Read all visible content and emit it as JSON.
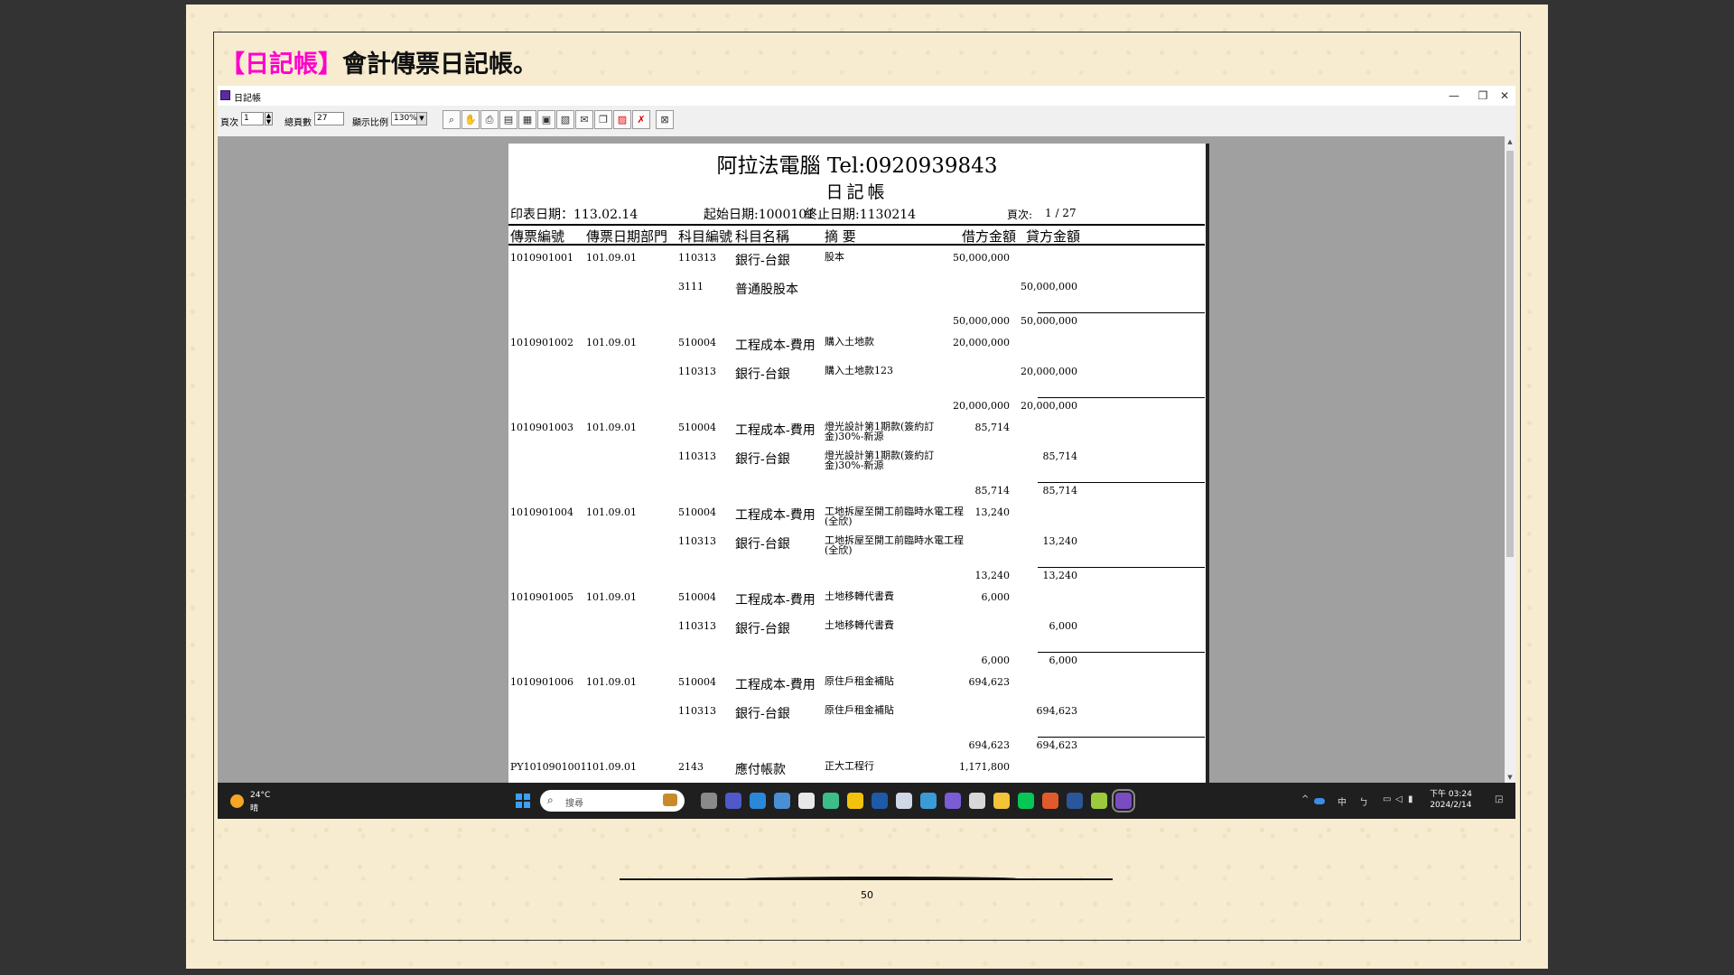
{
  "slide": {
    "heading_tag": "【日記帳】",
    "heading_text": "會計傳票日記帳。",
    "page_number": "50"
  },
  "window": {
    "title": "日記帳",
    "minimize": "—",
    "restore": "❐",
    "close": "✕"
  },
  "toolbar": {
    "page_label": "頁次",
    "page_value": "1",
    "total_label": "總頁數",
    "total_value": "27",
    "zoom_label": "顯示比例",
    "zoom_value": "130%",
    "buttons": [
      "search-icon",
      "hand-icon",
      "print-icon",
      "page-icon",
      "export-icon",
      "excel-icon",
      "word-icon",
      "mail-icon",
      "copy-icon",
      "pdf-icon",
      "delete-icon",
      "close-icon"
    ]
  },
  "report": {
    "company": "阿拉法電腦 Tel:0920939843",
    "title": "日記帳",
    "print_date": "印表日期：113.02.14",
    "start_date": "起始日期:1000101",
    "end_date": "終止日期:1130214",
    "page_label": "頁次:",
    "page_value": "1 / 27",
    "headers": [
      "傳票編號",
      "傳票日期",
      "部門",
      "科目編號",
      "科目名稱",
      "摘 要",
      "借方金額",
      "貸方金額"
    ],
    "vouchers": [
      {
        "no": "1010901001",
        "date": "101.09.01",
        "lines": [
          {
            "code": "110313",
            "name": "銀行-台銀",
            "desc": "股本",
            "debit": "50,000,000",
            "credit": ""
          },
          {
            "code": "3111",
            "name": "普通股股本",
            "desc": "",
            "debit": "",
            "credit": "50,000,000"
          }
        ],
        "total_debit": "50,000,000",
        "total_credit": "50,000,000"
      },
      {
        "no": "1010901002",
        "date": "101.09.01",
        "lines": [
          {
            "code": "510004",
            "name": "工程成本-費用",
            "desc": "購入土地款",
            "debit": "20,000,000",
            "credit": ""
          },
          {
            "code": "110313",
            "name": "銀行-台銀",
            "desc": "購入土地款123",
            "debit": "",
            "credit": "20,000,000"
          }
        ],
        "total_debit": "20,000,000",
        "total_credit": "20,000,000"
      },
      {
        "no": "1010901003",
        "date": "101.09.01",
        "lines": [
          {
            "code": "510004",
            "name": "工程成本-費用",
            "desc": "燈光設計第1期款(簽約訂金)30%-新源",
            "debit": "85,714",
            "credit": ""
          },
          {
            "code": "110313",
            "name": "銀行-台銀",
            "desc": "燈光設計第1期款(簽約訂金)30%-新源",
            "debit": "",
            "credit": "85,714"
          }
        ],
        "total_debit": "85,714",
        "total_credit": "85,714"
      },
      {
        "no": "1010901004",
        "date": "101.09.01",
        "lines": [
          {
            "code": "510004",
            "name": "工程成本-費用",
            "desc": "工地拆屋至開工前臨時水電工程(全欣)",
            "debit": "13,240",
            "credit": ""
          },
          {
            "code": "110313",
            "name": "銀行-台銀",
            "desc": "工地拆屋至開工前臨時水電工程(全欣)",
            "debit": "",
            "credit": "13,240"
          }
        ],
        "total_debit": "13,240",
        "total_credit": "13,240"
      },
      {
        "no": "1010901005",
        "date": "101.09.01",
        "lines": [
          {
            "code": "510004",
            "name": "工程成本-費用",
            "desc": "土地移轉代書費",
            "debit": "6,000",
            "credit": ""
          },
          {
            "code": "110313",
            "name": "銀行-台銀",
            "desc": "土地移轉代書費",
            "debit": "",
            "credit": "6,000"
          }
        ],
        "total_debit": "6,000",
        "total_credit": "6,000"
      },
      {
        "no": "1010901006",
        "date": "101.09.01",
        "lines": [
          {
            "code": "510004",
            "name": "工程成本-費用",
            "desc": "原住戶租金補貼",
            "debit": "694,623",
            "credit": ""
          },
          {
            "code": "110313",
            "name": "銀行-台銀",
            "desc": "原住戶租金補貼",
            "debit": "",
            "credit": "694,623"
          }
        ],
        "total_debit": "694,623",
        "total_credit": "694,623"
      },
      {
        "no": "PY1010901001",
        "date": "101.09.01",
        "lines": [
          {
            "code": "2143",
            "name": "應付帳款",
            "desc": "正大工程行",
            "debit": "1,171,800",
            "credit": ""
          }
        ],
        "total_debit": "",
        "total_credit": ""
      }
    ]
  },
  "taskbar": {
    "temperature": "24°C",
    "condition": "晴",
    "search_placeholder": "搜尋",
    "tray": [
      "^",
      "中",
      "ㄅ"
    ],
    "time": "下午 03:24",
    "date": "2024/2/14",
    "apps": [
      "#8a8a8a",
      "#5059c9",
      "#2b88d8",
      "#4a8fd4",
      "#e8e8e8",
      "#3dbd8a",
      "#f4c20d",
      "#1e5aa8",
      "#cfd8e6",
      "#3b9bd6",
      "#7b5cd6",
      "#d8d8d8",
      "#f3c33a",
      "#06c755",
      "#e05a2b",
      "#2b579a",
      "#9bcb3c",
      "#7a4cc2"
    ]
  },
  "colors": {
    "heading_accent": "#ff00cc",
    "slide_background": "#f7ecd0",
    "viewer_background": "#a0a0a0",
    "taskbar": "#1f1f1f"
  }
}
